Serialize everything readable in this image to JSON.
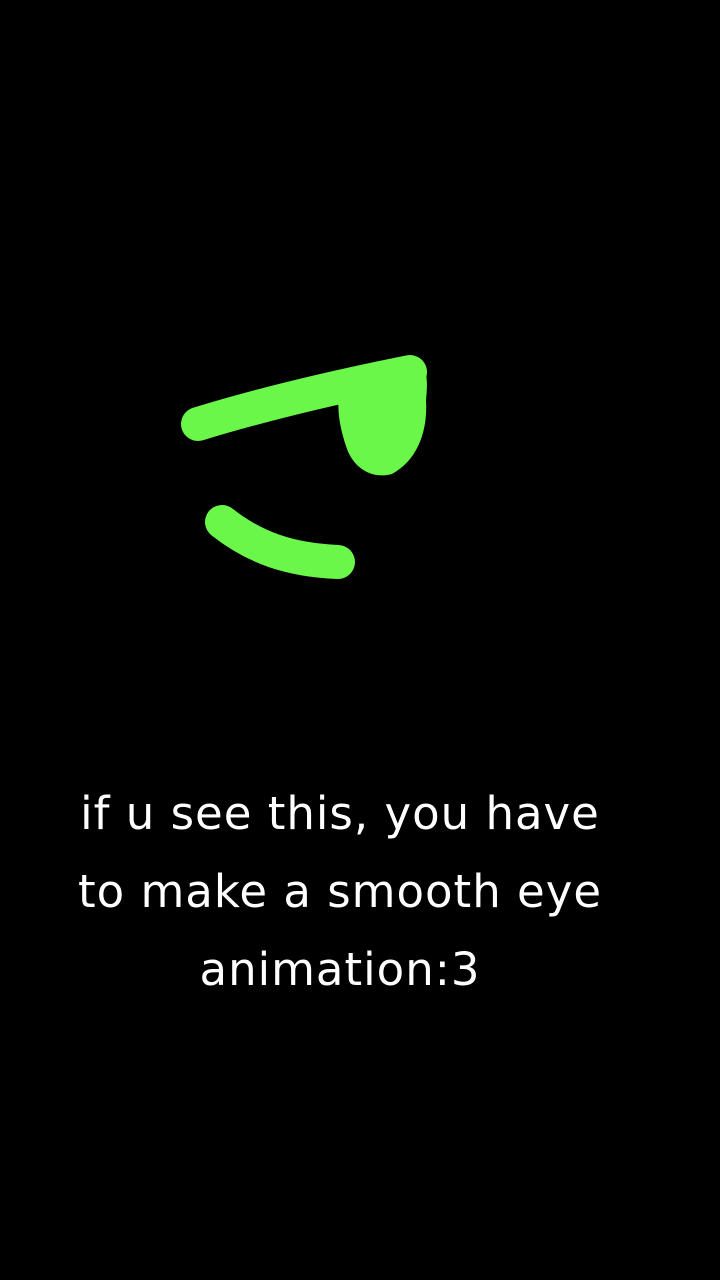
{
  "caption": {
    "lines": [
      "if u see this, you have",
      "to make a smooth eye",
      "animation:3"
    ]
  },
  "colors": {
    "background": "#000000",
    "stroke": "#6af74a",
    "text": "#ffffff"
  }
}
